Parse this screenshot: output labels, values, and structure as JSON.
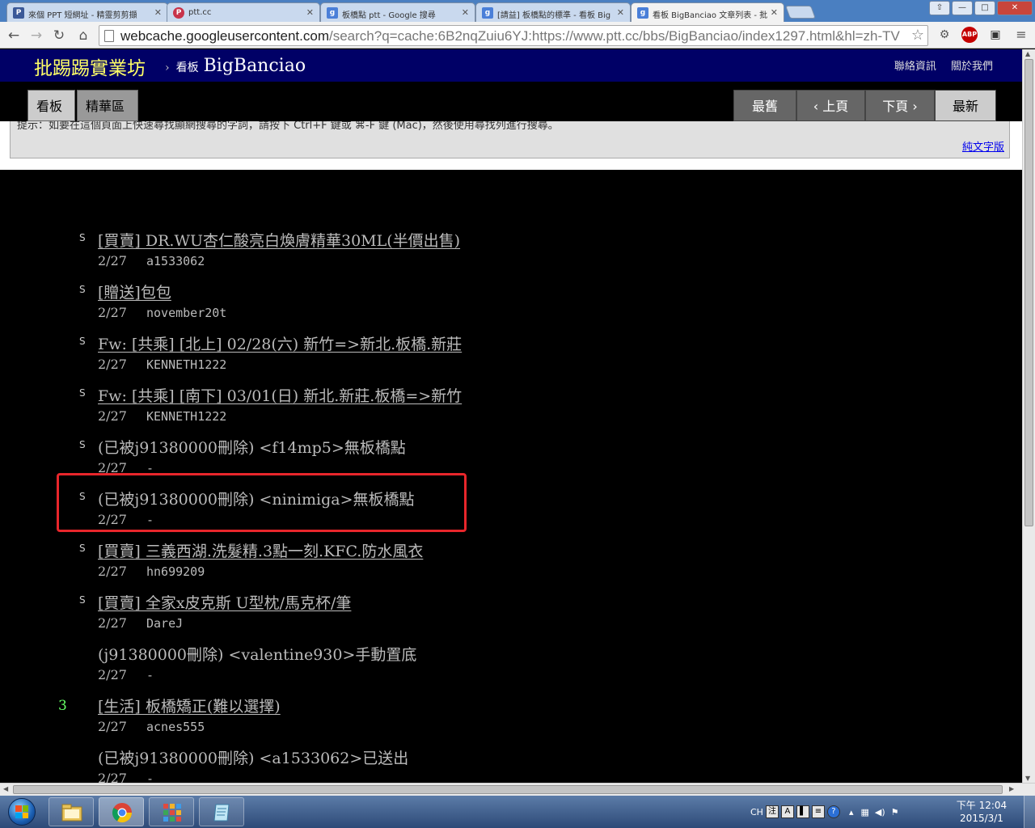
{
  "browser": {
    "tabs": [
      {
        "title": "來個 PPT 短網址 - 精靈剪剪擷",
        "favicon": "ptt-icon",
        "color": "#3b5998",
        "active": false
      },
      {
        "title": "ptt.cc",
        "favicon": "p-icon",
        "color": "#c8334a",
        "active": false
      },
      {
        "title": "板橋點 ptt - Google 搜尋",
        "favicon": "google-icon",
        "color": "#4a7fd8",
        "active": false
      },
      {
        "title": "[請益] 板橋點的標準 - 看板 Big",
        "favicon": "google-icon",
        "color": "#4a7fd8",
        "active": false
      },
      {
        "title": "看板 BigBanciao 文章列表 - 批",
        "favicon": "google-icon",
        "color": "#4a7fd8",
        "active": true
      }
    ],
    "url_host": "webcache.googleusercontent.com",
    "url_rest": "/search?q=cache:6B2nqZuiu6YJ:https://www.ptt.cc/bbs/BigBanciao/index1297.html&hl=zh-TV",
    "window_buttons": {
      "minimize": "—",
      "maximize": "□",
      "close": "✕",
      "user": "⇧"
    }
  },
  "site": {
    "title": "批踢踢實業坊",
    "crumb_sep": "›",
    "board_label": "看板",
    "board_name": "BigBanciao",
    "links": [
      "聯絡資訊",
      "關於我們"
    ]
  },
  "nav": {
    "left_buttons": [
      {
        "label": "看板",
        "active": true
      },
      {
        "label": "精華區",
        "active": false
      }
    ],
    "pager": [
      "最舊",
      "‹ 上頁",
      "下頁 ›",
      "最新"
    ]
  },
  "notice": {
    "tip": "提示：如要在這個頁面上快速尋找顯網搜尋的字詞，請按下 Ctrl+F 鍵或 ⌘-F 鍵 (Mac)，然後使用尋找列進行搜尋。",
    "plain_text_link": "純文字版"
  },
  "posts": [
    {
      "mark": "S",
      "count": "",
      "title": "[買賣] DR.WU杏仁酸亮白煥膚精華30ML(半價出售)",
      "date": "2/27",
      "author": "a1533062",
      "link": true
    },
    {
      "mark": "S",
      "count": "",
      "title": "[贈送]包包",
      "date": "2/27",
      "author": "november20t",
      "link": true
    },
    {
      "mark": "S",
      "count": "",
      "title": "Fw: [共乘] [北上] 02/28(六) 新竹=>新北.板橋.新莊",
      "date": "2/27",
      "author": "KENNETH1222",
      "link": true
    },
    {
      "mark": "S",
      "count": "",
      "title": "Fw: [共乘] [南下] 03/01(日) 新北.新莊.板橋=>新竹",
      "date": "2/27",
      "author": "KENNETH1222",
      "link": true
    },
    {
      "mark": "S",
      "count": "",
      "title": "(已被j91380000刪除) <f14mp5>無板橋點",
      "date": "2/27",
      "author": "-",
      "link": false
    },
    {
      "mark": "S",
      "count": "",
      "title": "(已被j91380000刪除) <ninimiga>無板橋點",
      "date": "2/27",
      "author": "-",
      "link": false
    },
    {
      "mark": "S",
      "count": "",
      "title": "[買賣] 三義西湖.洗髮精.3點一刻.KFC.防水風衣",
      "date": "2/27",
      "author": "hn699209",
      "link": true
    },
    {
      "mark": "S",
      "count": "",
      "title": "[買賣] 全家x皮克斯 U型枕/馬克杯/筆",
      "date": "2/27",
      "author": "DareJ",
      "link": true
    },
    {
      "mark": "",
      "count": "",
      "title": "(j91380000刪除) <valentine930>手動置底",
      "date": "2/27",
      "author": "-",
      "link": false
    },
    {
      "mark": "",
      "count": "3",
      "title": "[生活] 板橋矯正(難以選擇)",
      "date": "2/27",
      "author": "acnes555",
      "link": true
    },
    {
      "mark": "",
      "count": "",
      "title": "(已被j91380000刪除) <a1533062>已送出",
      "date": "2/27",
      "author": "-",
      "link": false
    }
  ],
  "taskbar": {
    "apps": [
      "file-explorer-icon",
      "chrome-icon",
      "apps-grid-icon",
      "notepad-icon"
    ],
    "tray_lang": "CH",
    "tray_icons": [
      "注",
      "A",
      "▌",
      "≡",
      "?"
    ],
    "clock_time": "下午 12:04",
    "clock_date": "2015/3/1"
  },
  "colors": {
    "site_bar": "#000066",
    "site_title": "#ffff66",
    "highlight_box": "#e8262b",
    "push_count": "#66ff66"
  }
}
